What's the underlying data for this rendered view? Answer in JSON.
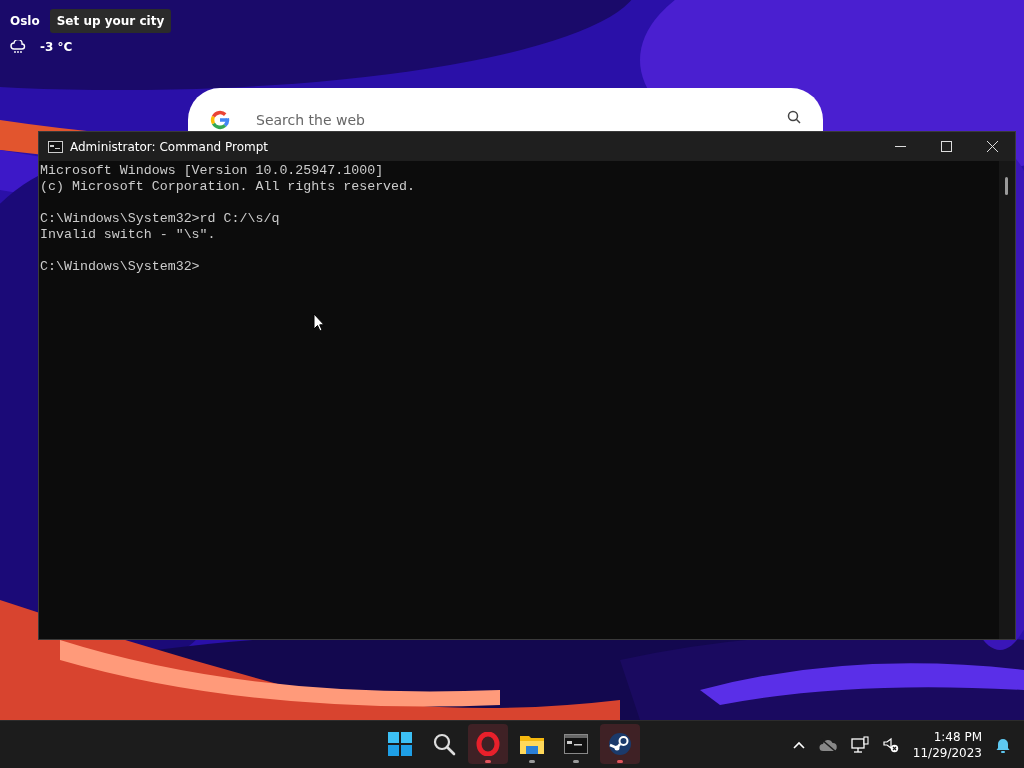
{
  "weather": {
    "city": "Oslo",
    "tooltip": "Set up your city",
    "temperature": "-3 °C"
  },
  "search": {
    "placeholder": "Search the web"
  },
  "window": {
    "title": "Administrator: Command Prompt",
    "output": [
      [
        "Microsoft Windows [Version 10.0.25947.1000]",
        "(c) Microsoft Corporation. All rights reserved."
      ],
      [
        "C:\\Windows\\System32>rd C:/\\s/q",
        "Invalid switch - \"\\s\"."
      ],
      [
        "C:\\Windows\\System32>"
      ]
    ]
  },
  "taskbar": {
    "apps": [
      {
        "kind": "start",
        "running": false,
        "attention": false
      },
      {
        "kind": "search",
        "running": false,
        "attention": false
      },
      {
        "kind": "opera",
        "running": true,
        "attention": true
      },
      {
        "kind": "explorer",
        "running": true,
        "attention": false
      },
      {
        "kind": "terminal",
        "running": true,
        "attention": false
      },
      {
        "kind": "steam",
        "running": true,
        "attention": true
      }
    ],
    "clock": {
      "time": "1:48 PM",
      "date": "11/29/2023"
    }
  }
}
